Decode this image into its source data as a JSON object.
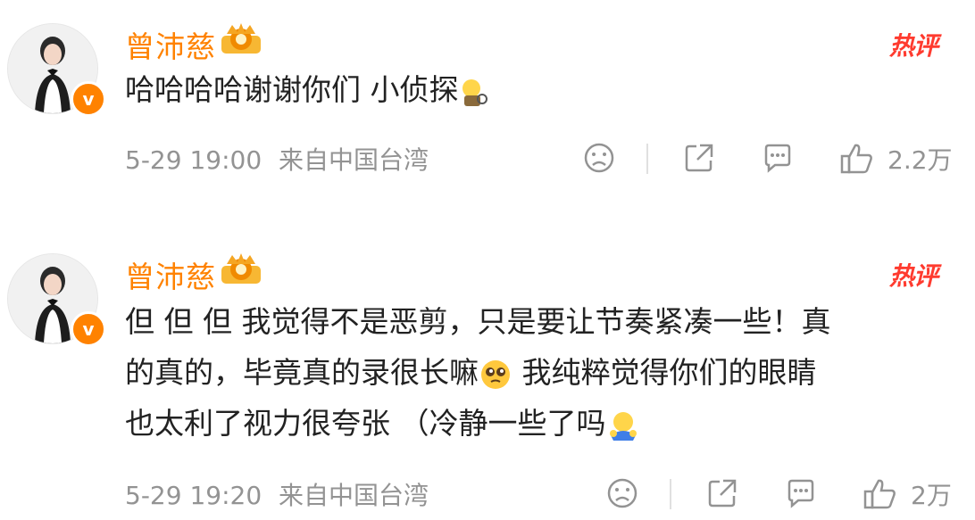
{
  "comments": [
    {
      "username": "曾沛慈",
      "hot_label": "热评",
      "line1": "哈哈哈哈谢谢你们 小侦探",
      "time": "5-29 19:00",
      "source": "来自中国台湾",
      "likes": "2.2万",
      "avatar_badge": "v"
    },
    {
      "username": "曾沛慈",
      "hot_label": "热评",
      "line1": "但 但 但 我觉得不是恶剪，只是要让节奏紧凑一些！真",
      "line2a": "的真的，毕竟真的录很长嘛",
      "line2b": " 我纯粹觉得你们的眼睛",
      "line3": "也太利了视力很夸张 （冷静一些了吗",
      "time": "5-29 19:20",
      "source": "来自中国台湾",
      "likes": "2万",
      "avatar_badge": "v"
    }
  ],
  "icons": {
    "dislike": "frown-face-icon",
    "share": "share-icon",
    "comment": "comment-icon",
    "like": "thumbs-up-icon"
  },
  "colors": {
    "username": "#ff8200",
    "hot": "#ff3b2f",
    "meta": "#939393",
    "text": "#222222"
  }
}
